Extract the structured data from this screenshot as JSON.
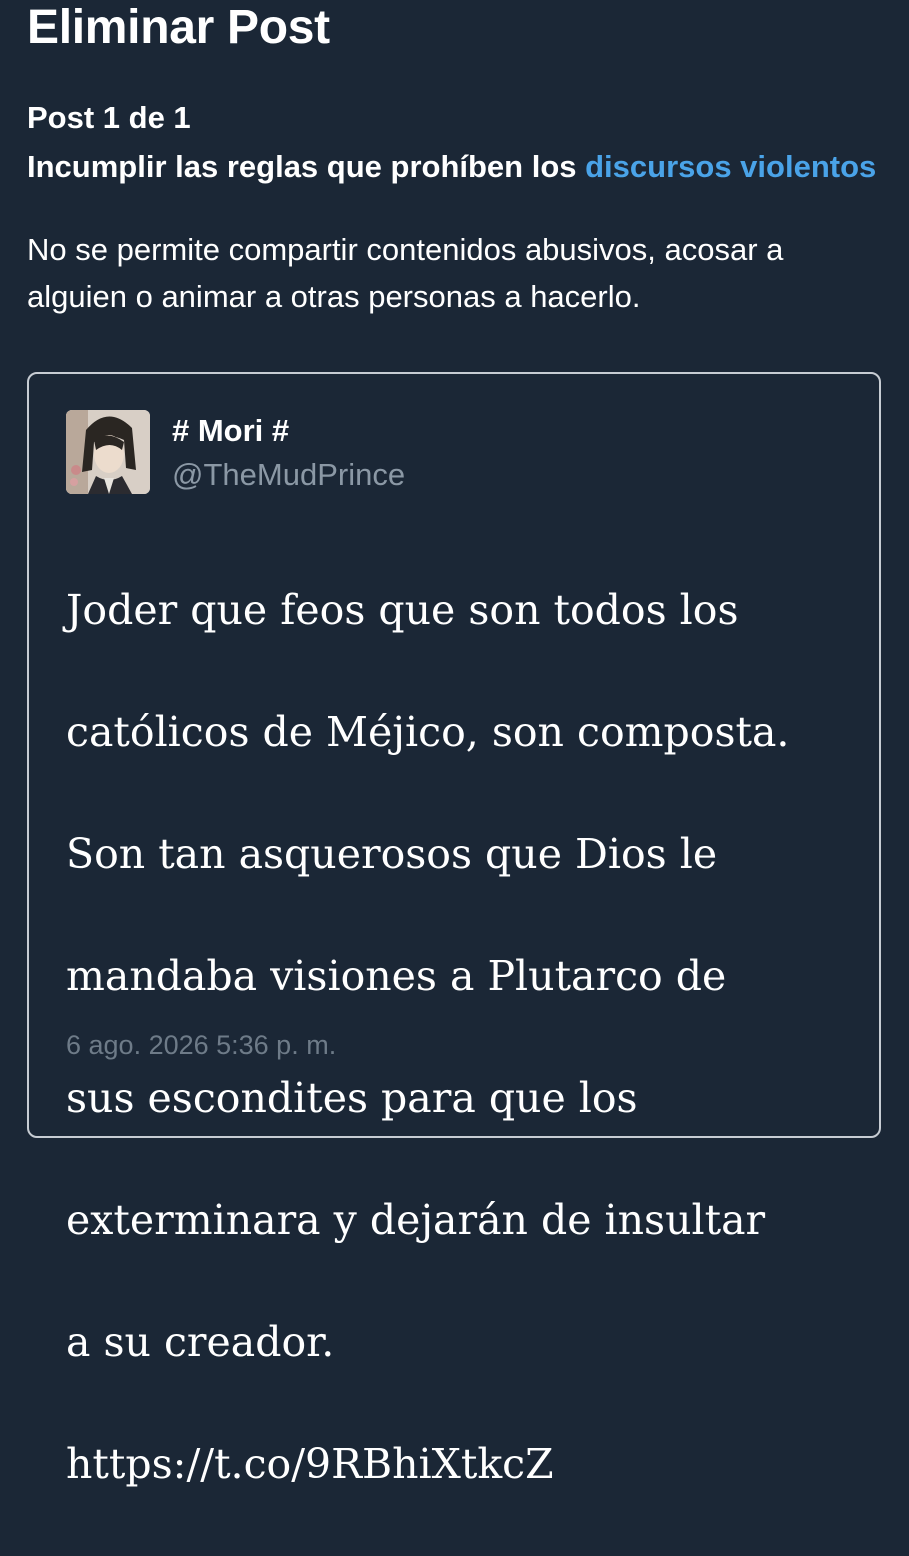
{
  "header": {
    "title": "Eliminar Post"
  },
  "report": {
    "counter": "Post 1 de 1",
    "rule_prefix": "Incumplir las reglas que prohíben los ",
    "rule_link": "discursos violentos",
    "rule_description": "No se permite compartir contenidos abusivos, acosar a alguien o animar a otras personas a hacerlo."
  },
  "tweet": {
    "display_name": "# Mori #",
    "handle": "@TheMudPrince",
    "lines": [
      "Joder que feos que son todos los",
      "católicos de Méjico, son composta.",
      "Son tan asquerosos que Dios le",
      "mandaba visiones a Plutarco de",
      "sus escondites para que los",
      "exterminara y dejarán de insultar",
      "a su creador.",
      "https://t.co/9RBhiXtkcZ"
    ],
    "timestamp": "6 ago. 2026 5:36 p. m."
  },
  "colors": {
    "background": "#1b2736",
    "link": "#4aa3e8",
    "muted": "#8b98a5",
    "card_border": "#c7ccd3"
  }
}
